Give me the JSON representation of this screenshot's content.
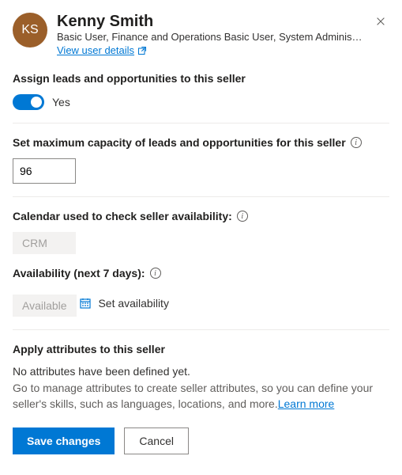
{
  "user": {
    "initials": "KS",
    "display_name": "Kenny Smith",
    "roles": "Basic User, Finance and Operations Basic User, System Administr…",
    "view_details_label": "View user details"
  },
  "assign": {
    "label": "Assign leads and opportunities to this seller",
    "toggle_state": "Yes"
  },
  "capacity": {
    "label": "Set maximum capacity of leads and opportunities for this seller",
    "value": "96"
  },
  "calendar": {
    "label": "Calendar used to check seller availability:",
    "value": "CRM"
  },
  "availability": {
    "label": "Availability (next 7 days):",
    "value": "Available",
    "set_label": "Set availability"
  },
  "attributes": {
    "label": "Apply attributes to this seller",
    "empty_text": "No attributes have been defined yet.",
    "help_text": "Go to manage attributes to create seller attributes, so you can define your seller's skills, such as languages, locations, and more.",
    "learn_more": "Learn more"
  },
  "footer": {
    "save": "Save changes",
    "cancel": "Cancel"
  }
}
